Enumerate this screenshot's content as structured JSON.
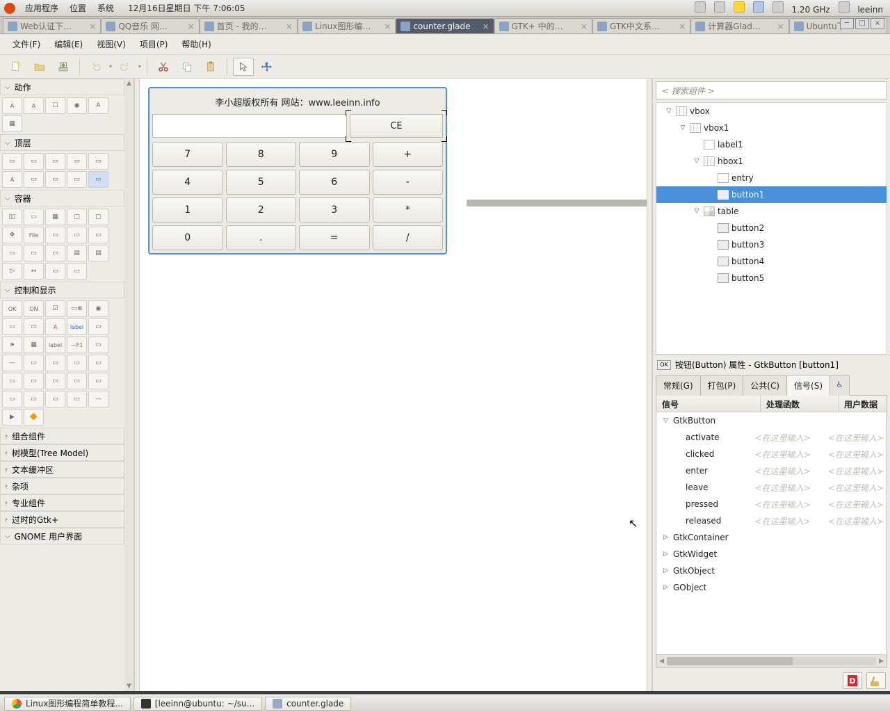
{
  "gnome": {
    "menus": [
      "应用程序",
      "位置",
      "系统"
    ],
    "date": "12月16日星期日 下午  7:06:05",
    "freq": "1.20 GHz",
    "user": "leeinn"
  },
  "tabs": [
    {
      "label": "Web认证下…"
    },
    {
      "label": "QQ音乐  网…"
    },
    {
      "label": "首页 - 我的…"
    },
    {
      "label": "Linux图形编…"
    },
    {
      "label": "counter.glade",
      "active": true
    },
    {
      "label": "GTK+ 中的…"
    },
    {
      "label": "GTK中文系…"
    },
    {
      "label": "计算器Glad…"
    },
    {
      "label": "Ubuntu下G…"
    }
  ],
  "menubar": {
    "file": "文件(F)",
    "edit": "编辑(E)",
    "view": "视图(V)",
    "project": "项目(P)",
    "help": "帮助(H)"
  },
  "palette": {
    "sections": {
      "actions": "动作",
      "toplevel": "顶层",
      "containers": "容器",
      "control": "控制和显示",
      "composite": "组合组件",
      "tree": "树模型(Tree Model)",
      "textbuf": "文本缓冲区",
      "misc": "杂项",
      "special": "专业组件",
      "deprecated": "过时的Gtk+",
      "gnomeui": "GNOME 用户界面"
    }
  },
  "design": {
    "title_label": "李小超版权所有   网站：www.leeinn.info",
    "ce": "CE",
    "buttons": [
      "7",
      "8",
      "9",
      "+",
      "4",
      "5",
      "6",
      "-",
      "1",
      "2",
      "3",
      "*",
      "0",
      ".",
      "=",
      "/"
    ]
  },
  "inspector": {
    "search_placeholder": "< 搜索组件 >",
    "tree": [
      {
        "label": "vbox",
        "depth": 0,
        "icon": "box",
        "exp": "▽"
      },
      {
        "label": "vbox1",
        "depth": 1,
        "icon": "box",
        "exp": "▽"
      },
      {
        "label": "label1",
        "depth": 2,
        "icon": "label",
        "exp": ""
      },
      {
        "label": "hbox1",
        "depth": 2,
        "icon": "box",
        "exp": "▽"
      },
      {
        "label": "entry",
        "depth": 3,
        "icon": "entry",
        "exp": ""
      },
      {
        "label": "button1",
        "depth": 3,
        "icon": "btn",
        "exp": "",
        "selected": true
      },
      {
        "label": "table",
        "depth": 2,
        "icon": "table",
        "exp": "▽"
      },
      {
        "label": "button2",
        "depth": 3,
        "icon": "btn",
        "exp": ""
      },
      {
        "label": "button3",
        "depth": 3,
        "icon": "btn",
        "exp": ""
      },
      {
        "label": "button4",
        "depth": 3,
        "icon": "btn",
        "exp": ""
      },
      {
        "label": "button5",
        "depth": 3,
        "icon": "btn",
        "exp": ""
      }
    ]
  },
  "props": {
    "header_prefix_icon": "OK",
    "header": "按钮(Button) 属性 - GtkButton [button1]",
    "tabs": {
      "general": "常规(G)",
      "packing": "打包(P)",
      "common": "公共(C)",
      "signals": "信号(S)"
    },
    "cols": {
      "signal": "信号",
      "handler": "处理函数",
      "userdata": "用户数据"
    },
    "hint": "<在这里输入>",
    "groups": [
      "GtkButton",
      "GtkContainer",
      "GtkWidget",
      "GtkObject",
      "GObject"
    ],
    "signals": [
      "activate",
      "clicked",
      "enter",
      "leave",
      "pressed",
      "released"
    ]
  },
  "taskbar": {
    "t1": "Linux图形编程简单教程...",
    "t2": "[leeinn@ubuntu: ~/su...",
    "t3": "counter.glade"
  }
}
